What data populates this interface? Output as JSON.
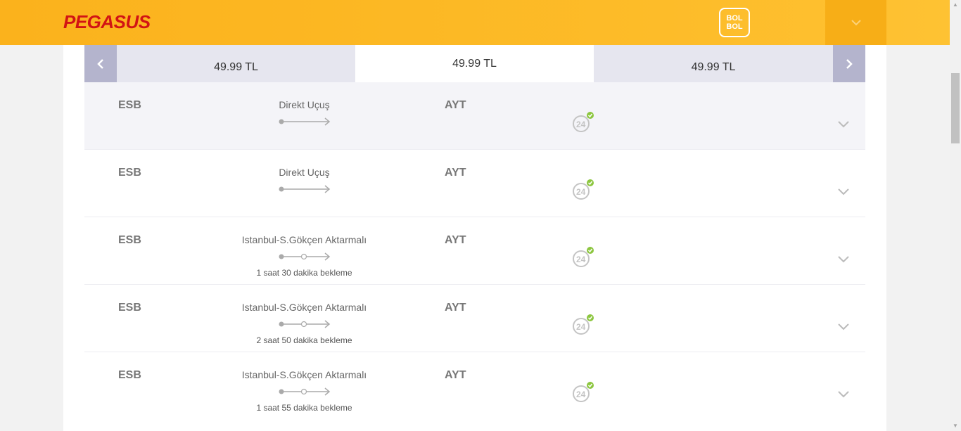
{
  "header": {
    "logo_text": "PEGASUS",
    "bolbol_line1": "BOL",
    "bolbol_line2": "BOL"
  },
  "date_selector": {
    "tabs": [
      {
        "price": "49.99 TL",
        "active": false
      },
      {
        "price": "49.99 TL",
        "active": true
      },
      {
        "price": "49.99 TL",
        "active": false
      }
    ]
  },
  "flights": [
    {
      "from": "ESB",
      "to": "AYT",
      "route": "Direkt Uçuş",
      "connection": false,
      "wait": ""
    },
    {
      "from": "ESB",
      "to": "AYT",
      "route": "Direkt Uçuş",
      "connection": false,
      "wait": ""
    },
    {
      "from": "ESB",
      "to": "AYT",
      "route": "Istanbul-S.Gökçen Aktarmalı",
      "connection": true,
      "wait": "1 saat 30 dakika bekleme"
    },
    {
      "from": "ESB",
      "to": "AYT",
      "route": "Istanbul-S.Gökçen Aktarmalı",
      "connection": true,
      "wait": "2 saat 50 dakika bekleme"
    },
    {
      "from": "ESB",
      "to": "AYT",
      "route": "Istanbul-S.Gökçen Aktarmalı",
      "connection": true,
      "wait": "1 saat 55 dakika bekleme"
    }
  ],
  "colors": {
    "header_bg": "#fbb21c",
    "logo_red": "#d21414",
    "badge_check": "#8cc63f"
  },
  "icons": {
    "prev": "chevron-left-icon",
    "next": "chevron-right-icon",
    "expand": "chevron-down-icon",
    "badge": "24h-check-icon"
  }
}
